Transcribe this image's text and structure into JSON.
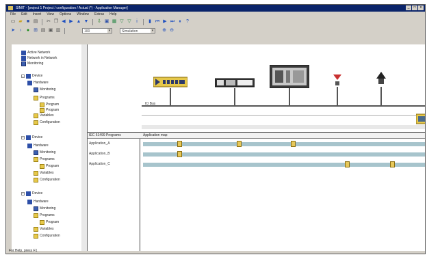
{
  "window": {
    "title": "SIMIT - [project 1 Project / configuration / Actual (*) - Application Manager]",
    "controls": [
      "_",
      "□",
      "x"
    ]
  },
  "menu": [
    "File",
    "Edit",
    "Insert",
    "View",
    "Options",
    "Window",
    "Extras",
    "Help"
  ],
  "toolbar2": {
    "zoom_value": "100",
    "mode_value": "Simulation"
  },
  "tree": {
    "items": [
      {
        "label": "Active Network",
        "icon": "network-icon"
      },
      {
        "label": "Network in Network",
        "icon": "network-icon"
      },
      {
        "label": "Monitoring",
        "icon": "monitor-icon"
      },
      {
        "label": "Device",
        "icon": "device-icon"
      },
      {
        "label": "Hardware",
        "icon": "hardware-icon"
      },
      {
        "label": "Monitoring",
        "icon": "monitor-icon"
      },
      {
        "label": "Programs",
        "icon": "folder-icon"
      },
      {
        "label": "Program",
        "icon": "program-icon"
      },
      {
        "label": "Program",
        "icon": "program-icon"
      },
      {
        "label": "Variables",
        "icon": "variables-icon"
      },
      {
        "label": "Configuration",
        "icon": "config-icon"
      },
      {
        "label": "Device",
        "icon": "device-icon"
      },
      {
        "label": "Hardware",
        "icon": "hardware-icon"
      },
      {
        "label": "Monitoring",
        "icon": "monitor-icon"
      },
      {
        "label": "Programs",
        "icon": "folder-icon"
      },
      {
        "label": "Program",
        "icon": "program-icon"
      },
      {
        "label": "Variables",
        "icon": "variables-icon"
      },
      {
        "label": "Configuration",
        "icon": "config-icon"
      },
      {
        "label": "Device",
        "icon": "device-icon"
      },
      {
        "label": "Hardware",
        "icon": "hardware-icon"
      },
      {
        "label": "Monitoring",
        "icon": "monitor-icon"
      },
      {
        "label": "Programs",
        "icon": "folder-icon"
      },
      {
        "label": "Program",
        "icon": "program-icon"
      },
      {
        "label": "Variables",
        "icon": "variables-icon"
      },
      {
        "label": "Configuration",
        "icon": "config-icon"
      }
    ]
  },
  "network": {
    "label": "IO Bus"
  },
  "programs_table": {
    "col1": "IEC 61499 Programs",
    "col2": "Application map",
    "rows": [
      {
        "name": "Application_A",
        "markers": [
          0.12,
          0.33,
          0.52
        ]
      },
      {
        "name": "Application_B",
        "markers": [
          0.12
        ]
      },
      {
        "name": "Application_C",
        "markers": [
          0.71,
          0.87
        ]
      }
    ]
  },
  "status": "For Help, press F1",
  "colors": {
    "title_bg": "#0a246a",
    "bar_fill": "#a7c4cc",
    "marker_fill": "#e7c85a"
  }
}
